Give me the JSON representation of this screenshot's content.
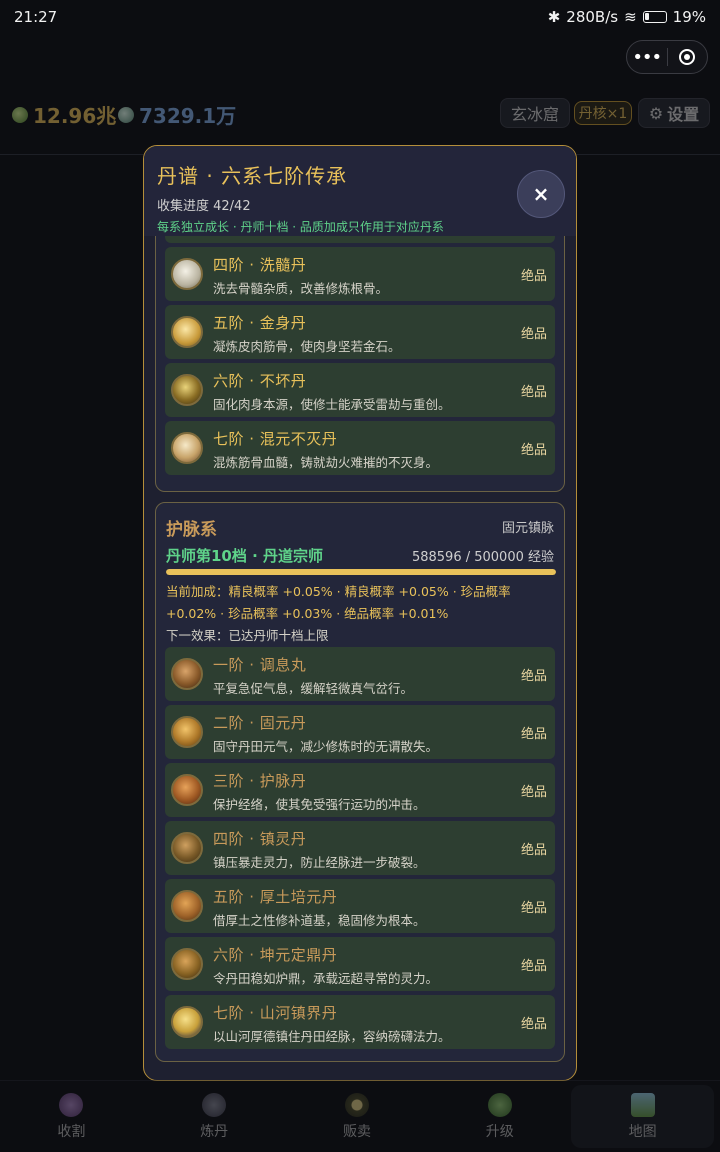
{
  "status_bar": {
    "time": "21:27",
    "net_speed": "280B/s",
    "battery": "19%"
  },
  "header": {
    "currency_gold": "12.96兆",
    "currency_jade": "7329.1万",
    "location": "玄冰窟",
    "dan_core": "丹核×1",
    "settings": "设置"
  },
  "modal": {
    "title": "丹谱 · 六系七阶传承",
    "progress": "收集进度 42/42",
    "note": "每系独立成长 · 丹师十档 · 品质加成只作用于对应丹系",
    "close": "×",
    "section1": {
      "items": [
        {
          "name": "四阶 · 洗髓丹",
          "desc": "洗去骨髓杂质，改善修炼根骨。",
          "grade": "绝品"
        },
        {
          "name": "五阶 · 金身丹",
          "desc": "凝炼皮肉筋骨，使肉身坚若金石。",
          "grade": "绝品"
        },
        {
          "name": "六阶 · 不坏丹",
          "desc": "固化肉身本源，使修士能承受雷劫与重创。",
          "grade": "绝品"
        },
        {
          "name": "七阶 · 混元不灭丹",
          "desc": "混炼筋骨血髓，铸就劫火难摧的不灭身。",
          "grade": "绝品"
        }
      ]
    },
    "section2": {
      "title": "护脉系",
      "tag": "固元镇脉",
      "rank": "丹师第10档 · 丹道宗师",
      "exp": "588596 / 500000 经验",
      "progress_fraction": 1.0,
      "bonus_line1": "当前加成：精良概率 +0.05% · 精良概率 +0.05% · 珍品概率",
      "bonus_line2": "+0.02% · 珍品概率 +0.03% · 绝品概率 +0.01%",
      "next_effect": "下一效果：已达丹师十档上限",
      "items": [
        {
          "name": "一阶 · 调息丸",
          "desc": "平复急促气息，缓解轻微真气岔行。",
          "grade": "绝品"
        },
        {
          "name": "二阶 · 固元丹",
          "desc": "固守丹田元气，减少修炼时的无谓散失。",
          "grade": "绝品"
        },
        {
          "name": "三阶 · 护脉丹",
          "desc": "保护经络，使其免受强行运功的冲击。",
          "grade": "绝品"
        },
        {
          "name": "四阶 · 镇灵丹",
          "desc": "镇压暴走灵力，防止经脉进一步破裂。",
          "grade": "绝品"
        },
        {
          "name": "五阶 · 厚土培元丹",
          "desc": "借厚土之性修补道基，稳固修为根本。",
          "grade": "绝品"
        },
        {
          "name": "六阶 · 坤元定鼎丹",
          "desc": "令丹田稳如炉鼎，承载远超寻常的灵力。",
          "grade": "绝品"
        },
        {
          "name": "七阶 · 山河镇界丹",
          "desc": "以山河厚德镇住丹田经脉，容纳磅礴法力。",
          "grade": "绝品"
        }
      ]
    }
  },
  "bottom_nav": [
    {
      "label": "收割",
      "icon": "harvest-icon"
    },
    {
      "label": "炼丹",
      "icon": "alchemy-icon"
    },
    {
      "label": "贩卖",
      "icon": "sell-icon"
    },
    {
      "label": "升级",
      "icon": "upgrade-icon"
    },
    {
      "label": "地图",
      "icon": "map-icon"
    }
  ],
  "colors": {
    "accent_gold": "#e8c15a",
    "accent_green": "#5fd38a",
    "modal_bg": "#1e2030",
    "pill_bg": "#2d3e31"
  }
}
